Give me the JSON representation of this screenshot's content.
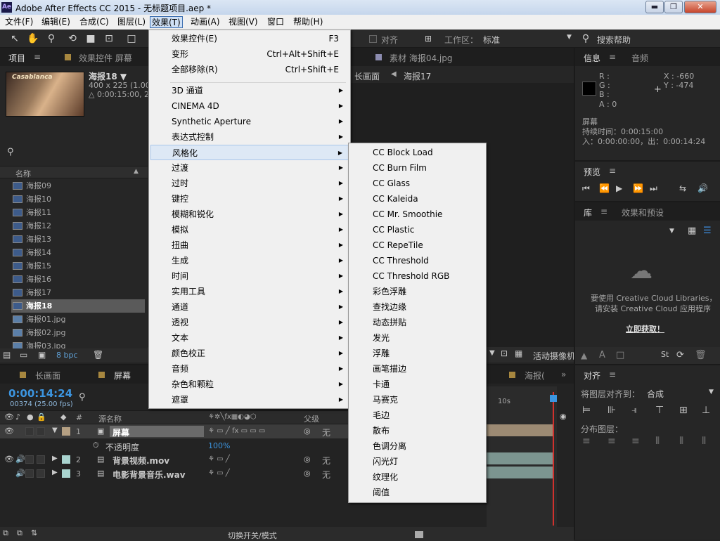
{
  "titlebar": {
    "app_icon": "Ae",
    "title": "Adobe After Effects CC 2015 - 无标题项目.aep *"
  },
  "menubar": [
    "文件(F)",
    "编辑(E)",
    "合成(C)",
    "图层(L)",
    "效果(T)",
    "动画(A)",
    "视图(V)",
    "窗口",
    "帮助(H)"
  ],
  "toolbar": {
    "snap_label": "对齐",
    "workspace_label": "工作区：",
    "workspace_value": "标准",
    "search_help": "搜索帮助"
  },
  "project_panel": {
    "tab_project": "项目",
    "tab_effects": "效果控件 屏幕",
    "item_name": "海报18 ▼",
    "item_size": "400 x 225 (1.00)",
    "item_duration": "△ 0:00:15:00, 25",
    "poster_text": "Casablanca",
    "col_name": "名称",
    "bpc": "8 bpc",
    "items": [
      "海报09",
      "海报10",
      "海报11",
      "海报12",
      "海报13",
      "海报14",
      "海报15",
      "海报16",
      "海报17",
      "海报18",
      "海报01.jpg",
      "海报02.jpg",
      "海报03.jpg"
    ]
  },
  "viewer": {
    "tab_footage": "素材 海报04.jpg",
    "crumb1": "长画面",
    "crumb2": "海报17",
    "active_camera": "活动摄像机"
  },
  "info_panel": {
    "tab_info": "信息",
    "tab_audio": "音频",
    "r": "R :",
    "g": "G :",
    "b": "B :",
    "a": "A : 0",
    "x": "X : -660",
    "y": "Y : -474",
    "layer_name": "屏幕",
    "duration": "持续时间：0:00:15:00",
    "inout": "入：0:00:00:00，出：0:00:14:24"
  },
  "preview_panel": {
    "title": "预览"
  },
  "library_panel": {
    "tab_library": "库",
    "tab_effects": "效果和预设",
    "msg1": "要使用 Creative Cloud Libraries，",
    "msg2": "请安装 Creative Cloud 应用程序",
    "link": "立即获取！"
  },
  "align_panel": {
    "title": "对齐",
    "align_to_label": "将图层对齐到：",
    "align_to_value": "合成",
    "distribute_label": "分布图层："
  },
  "timeline": {
    "tab1": "长画面",
    "tab2": "屏幕",
    "tab3": "海报(",
    "timecode": "0:00:14:24",
    "frames": "00374 (25.00 fps)",
    "col_hash": "#",
    "col_source": "源名称",
    "col_parent": "父级",
    "time_marker": "10s",
    "toggle_label": "切换开关/模式",
    "layers": [
      {
        "num": "1",
        "name": "屏幕",
        "parent": "无"
      },
      {
        "num": "2",
        "name": "背景视频.mov",
        "parent": "无"
      },
      {
        "num": "3",
        "name": "电影背景音乐.wav",
        "parent": "无"
      }
    ],
    "opacity_label": "不透明度",
    "opacity_value": "100%"
  },
  "effects_menu": {
    "group1": [
      {
        "label": "效果控件(E)",
        "shortcut": "F3"
      },
      {
        "label": "变形",
        "shortcut": "Ctrl+Alt+Shift+E"
      },
      {
        "label": "全部移除(R)",
        "shortcut": "Ctrl+Shift+E"
      }
    ],
    "group2": [
      "3D 通道",
      "CINEMA 4D",
      "Synthetic Aperture",
      "表达式控制",
      "风格化",
      "过渡",
      "过时",
      "键控",
      "模糊和锐化",
      "模拟",
      "扭曲",
      "生成",
      "时间",
      "实用工具",
      "通道",
      "透视",
      "文本",
      "颜色校正",
      "音频",
      "杂色和颗粒",
      "遮罩"
    ]
  },
  "stylize_submenu": [
    "CC Block Load",
    "CC Burn Film",
    "CC Glass",
    "CC Kaleida",
    "CC Mr. Smoothie",
    "CC Plastic",
    "CC RepeTile",
    "CC Threshold",
    "CC Threshold RGB",
    "彩色浮雕",
    "查找边缘",
    "动态拼贴",
    "发光",
    "浮雕",
    "画笔描边",
    "卡通",
    "马赛克",
    "毛边",
    "散布",
    "色调分离",
    "闪光灯",
    "纹理化",
    "阈值"
  ]
}
